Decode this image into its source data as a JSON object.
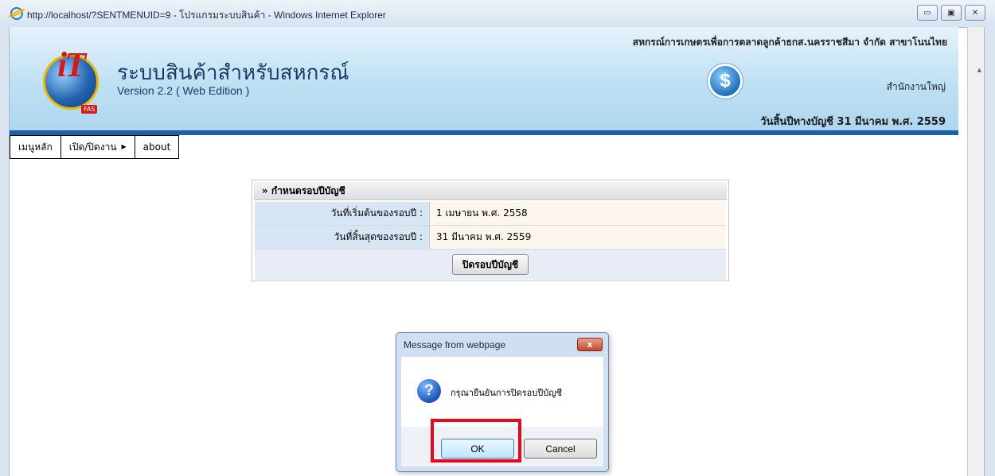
{
  "window": {
    "title": "http://localhost/?SENTMENUID=9 - โปรแกรมระบบสินค้า - Windows Internet Explorer",
    "minimize_label": "▭",
    "maximize_label": "▣",
    "close_label": "✕"
  },
  "header": {
    "app_title": "ระบบสินค้าสำหรับสหกรณ์",
    "version": "Version 2.2 ( Web Edition )",
    "coop_name": "สหกรณ์การเกษตรเพื่อการตลาดลูกค้าธกส.นครราชสีมา จำกัด สาขาโนนไทย",
    "office": "สำนักงานใหญ่",
    "fiscal_year_end": "วันสิ้นปีทางบัญชี 31 มีนาคม พ.ศ. 2559",
    "logo_text": "iT",
    "logo_badge": "FAS",
    "dollar_symbol": "$"
  },
  "menu": {
    "items": [
      {
        "label": "เมนูหลัก"
      },
      {
        "label": "เปิด/ปิดงาน",
        "has_submenu": true
      },
      {
        "label": "about"
      }
    ]
  },
  "panel": {
    "title": "» กำหนดรอบปีบัญชี",
    "rows": [
      {
        "label": "วันที่เริ่มต้นของรอบปี :",
        "value": "1 เมษายน พ.ศ. 2558"
      },
      {
        "label": "วันที่สิ้นสุดของรอบปี :",
        "value": "31 มีนาคม พ.ศ. 2559"
      }
    ],
    "button_label": "ปิดรอบปีบัญชี"
  },
  "dialog": {
    "title": "Message from webpage",
    "message": "กรุณายืนยันการปิดรอบปีบัญชี",
    "ok_label": "OK",
    "cancel_label": "Cancel",
    "icon": "question-icon",
    "close_glyph": "x"
  },
  "colors": {
    "header_band": "#1d5fa8",
    "highlight": "#e8071a"
  }
}
